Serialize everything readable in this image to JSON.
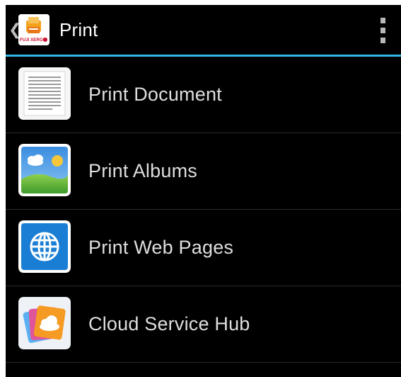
{
  "action_bar": {
    "title": "Print",
    "app_icon": "fuji-xerox-print-app-icon",
    "app_icon_text": "FUJI XEROX",
    "back_icon": "chevron-left-icon",
    "overflow_icon": "overflow-menu-icon"
  },
  "colors": {
    "background": "#000000",
    "accent": "#33b5e5",
    "title_text": "#ffffff",
    "item_text": "#dedede",
    "divider": "#2a2a2a"
  },
  "menu": {
    "items": [
      {
        "label": "Print Document",
        "icon": "document-icon"
      },
      {
        "label": "Print Albums",
        "icon": "photo-album-icon"
      },
      {
        "label": "Print Web Pages",
        "icon": "globe-icon"
      },
      {
        "label": "Cloud Service Hub",
        "icon": "cloud-icon"
      }
    ]
  }
}
